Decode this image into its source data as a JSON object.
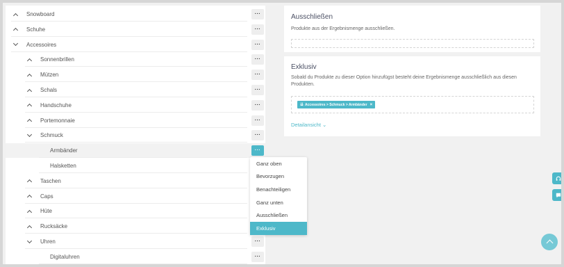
{
  "tree": {
    "items": [
      {
        "label": "Snowboard",
        "chevron": "up"
      },
      {
        "label": "Schuhe",
        "chevron": "up"
      },
      {
        "label": "Accessoires",
        "chevron": "down"
      },
      {
        "label": "Sonnenbrillen",
        "chevron": "up"
      },
      {
        "label": "Mützen",
        "chevron": "up"
      },
      {
        "label": "Schals",
        "chevron": "up"
      },
      {
        "label": "Handschuhe",
        "chevron": "up"
      },
      {
        "label": "Portemonnaie",
        "chevron": "up"
      },
      {
        "label": "Schmuck",
        "chevron": "down"
      },
      {
        "label": "Armbänder",
        "chevron": "none"
      },
      {
        "label": "Halsketten",
        "chevron": "none"
      },
      {
        "label": "Taschen",
        "chevron": "up"
      },
      {
        "label": "Caps",
        "chevron": "up"
      },
      {
        "label": "Hüte",
        "chevron": "up"
      },
      {
        "label": "Rucksäcke",
        "chevron": "up"
      },
      {
        "label": "Uhren",
        "chevron": "down"
      },
      {
        "label": "Digitaluhren",
        "chevron": "none"
      }
    ],
    "more_label": "···"
  },
  "context_menu": {
    "items": [
      "Ganz oben",
      "Bevorzugen",
      "Benachteiligen",
      "Ganz unten",
      "Ausschließen",
      "Exklusiv"
    ],
    "selected": "Exklusiv"
  },
  "exclude_panel": {
    "title": "Ausschließen",
    "description": "Produkte aus der Ergebnismenge ausschließen."
  },
  "exclusive_panel": {
    "title": "Exklusiv",
    "description_line1": "Sobald du Produkte zu dieser Option hinzufügst besteht deine Ergebnismenge ausschließlich aus diesen",
    "description_line2": "Produkten.",
    "tag_label": "Accessoires > Schmuck > Armbänder",
    "tag_close": "×",
    "tag_icon": "⇊",
    "detail_link": "Detailansicht ⌄"
  },
  "side_widgets": {
    "top_icon": "headset-icon",
    "bottom_icon": "chat-icon"
  },
  "colors": {
    "accent": "#4db8c9",
    "background": "#f1f1f1",
    "frame": "#d6d6d6"
  }
}
